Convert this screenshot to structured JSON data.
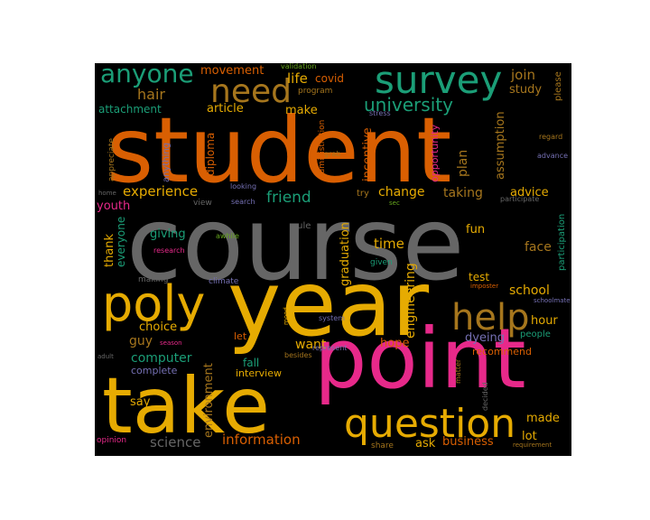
{
  "word_cloud": {
    "background": "#000000",
    "palette": {
      "orange": "#d95f02",
      "gray": "#666666",
      "gold": "#e6ab02",
      "pink": "#e7298a",
      "green": "#1b9e77",
      "purple": "#7570b3",
      "olive": "#66a61e",
      "brown": "#a6761d"
    },
    "words": {
      "student": "student",
      "course": "course",
      "year": "year",
      "point": "point",
      "take": "take",
      "question": "question",
      "poly": "poly",
      "survey": "survey",
      "anyone": "anyone",
      "need": "need",
      "help": "help",
      "university": "university",
      "experience": "experience",
      "friend": "friend",
      "change": "change",
      "taking": "taking",
      "advice": "advice",
      "movement": "movement",
      "join": "join",
      "study": "study",
      "life": "life",
      "covid": "covid",
      "program": "program",
      "hair": "hair",
      "attachment": "attachment",
      "article": "article",
      "make": "make",
      "validation": "validation",
      "please": "please",
      "stress": "stress",
      "incentive": "incentive",
      "opportunity": "opportunity",
      "plan": "plan",
      "assumption": "assumption",
      "administration": "administration",
      "diploma": "diploma",
      "anything": "anything",
      "appreciate": "appreciate",
      "grab": "grab",
      "regard": "regard",
      "advance": "advance",
      "looking": "looking",
      "home": "home",
      "view": "view",
      "search": "search",
      "try": "try",
      "sec": "sec",
      "participate": "participate",
      "youth": "youth",
      "rule": "rule",
      "time": "time",
      "graduation": "graduation",
      "fun": "fun",
      "participation": "participation",
      "thank": "thank",
      "everyone": "everyone",
      "giving": "giving",
      "awhile": "awhile",
      "research": "research",
      "engineering": "engineering",
      "face": "face",
      "test": "test",
      "given": "given",
      "climate": "climate",
      "making": "making",
      "imposter": "imposter",
      "school": "school",
      "schoolmate": "schoolmate",
      "choice": "choice",
      "hour": "hour",
      "mood": "mood",
      "system": "system",
      "guy": "guy",
      "season": "season",
      "let": "let",
      "want": "want",
      "hope": "hope",
      "dyeing": "dyeing",
      "people": "people",
      "represent": "represent",
      "computer": "computer",
      "recommend": "recommend",
      "adult": "adult",
      "besides": "besides",
      "fall": "fall",
      "complete": "complete",
      "interview": "interview",
      "environment": "environment",
      "matter": "matter",
      "decided": "decided",
      "say": "say",
      "made": "made",
      "information": "information",
      "science": "science",
      "ask": "ask",
      "business": "business",
      "lot": "lot",
      "opinion": "opinion",
      "share": "share",
      "requirement": "requirement"
    }
  }
}
